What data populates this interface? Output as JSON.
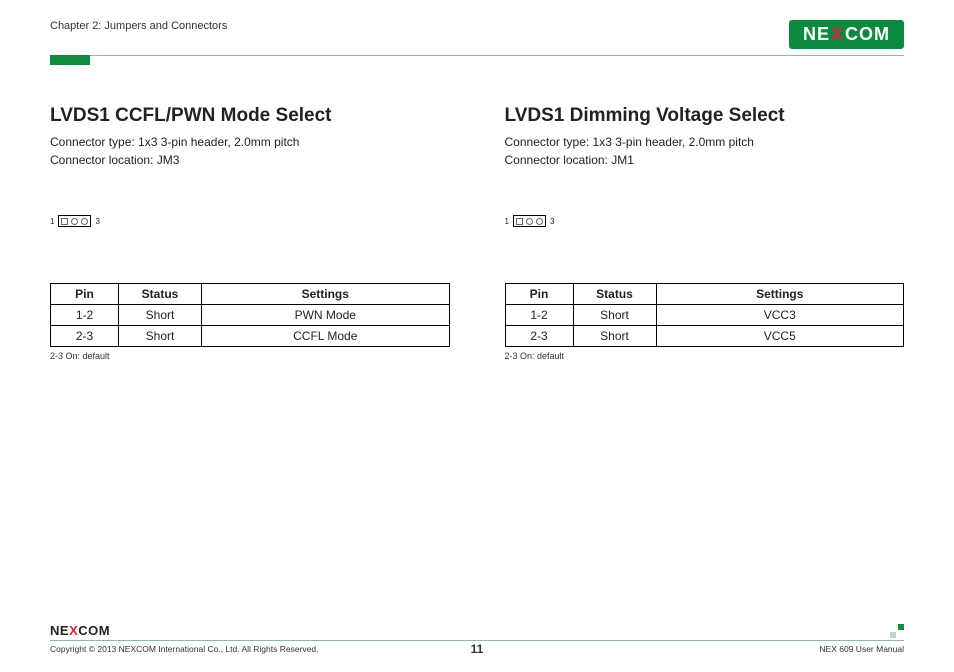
{
  "header": {
    "chapter": "Chapter 2: Jumpers and Connectors",
    "brand": {
      "pre": "NE",
      "x": "X",
      "post": "COM"
    }
  },
  "sections": [
    {
      "title": "LVDS1 CCFL/PWN Mode Select",
      "connector_type": "Connector type: 1x3 3-pin header, 2.0mm pitch",
      "connector_loc": "Connector location: JM3",
      "jumper_left_label": "1",
      "jumper_right_label": "3",
      "table": {
        "headers": [
          "Pin",
          "Status",
          "Settings"
        ],
        "rows": [
          [
            "1-2",
            "Short",
            "PWN Mode"
          ],
          [
            "2-3",
            "Short",
            "CCFL Mode"
          ]
        ]
      },
      "note": "2-3 On: default"
    },
    {
      "title": "LVDS1 Dimming Voltage Select",
      "connector_type": "Connector type: 1x3 3-pin header, 2.0mm pitch",
      "connector_loc": "Connector location: JM1",
      "jumper_left_label": "1",
      "jumper_right_label": "3",
      "table": {
        "headers": [
          "Pin",
          "Status",
          "Settings"
        ],
        "rows": [
          [
            "1-2",
            "Short",
            "VCC3"
          ],
          [
            "2-3",
            "Short",
            "VCC5"
          ]
        ]
      },
      "note": "2-3 On: default"
    }
  ],
  "footer": {
    "brand": {
      "pre": "NE",
      "x": "X",
      "post": "COM"
    },
    "copyright": "Copyright © 2013 NEXCOM International Co., Ltd. All Rights Reserved.",
    "page": "11",
    "manual": "NEX 609 User Manual"
  }
}
